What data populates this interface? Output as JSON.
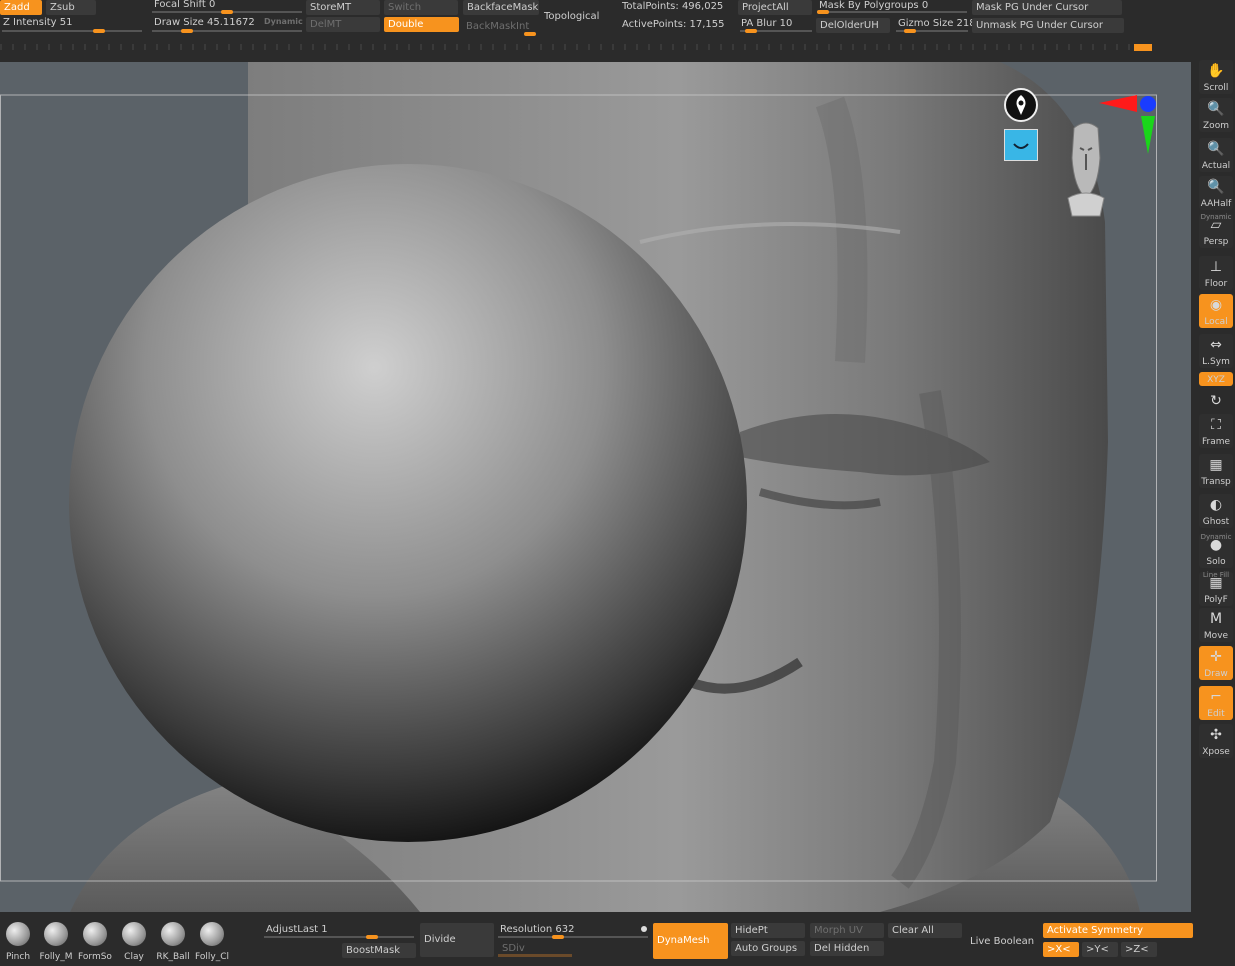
{
  "top": {
    "zadd": "Zadd",
    "zsub": "Zsub",
    "z_intensity": "Z Intensity 51",
    "focal_shift": "Focal Shift 0",
    "draw_size": "Draw Size 45.11672",
    "dynamic": "Dynamic",
    "storemt": "StoreMT",
    "delmt": "DelMT",
    "switch": "Switch",
    "double": "Double",
    "backfacemask": "BackfaceMask",
    "backmaskint": "BackMaskInt",
    "topological": "Topological",
    "total_points": "TotalPoints: 496,025",
    "active_points": "ActivePoints: 17,155",
    "projectall": "ProjectAll",
    "pa_blur": "PA Blur 10",
    "mask_by_polygroups": "Mask By Polygroups 0",
    "delolderuh": "DelOlderUH",
    "gizmo_size": "Gizmo Size 218",
    "mask_pg": "Mask PG Under Cursor",
    "unmask_pg": "Unmask PG Under Cursor"
  },
  "slider_values": {
    "z_intensity": 51,
    "focal_shift": 0,
    "draw_size": 45.11672,
    "pa_blur": 10,
    "gizmo_size": 218
  },
  "right": [
    {
      "label": "Scroll",
      "icon": "hand-icon",
      "glyph": "✋",
      "active": false,
      "top": ""
    },
    {
      "label": "Zoom",
      "icon": "magnifier-icon",
      "glyph": "🔍",
      "active": false,
      "top": ""
    },
    {
      "label": "Actual",
      "icon": "magnifier-icon",
      "glyph": "🔍",
      "active": false,
      "top": ""
    },
    {
      "label": "AAHalf",
      "icon": "magnifier-icon",
      "glyph": "🔍",
      "active": false,
      "top": ""
    },
    {
      "label": "Persp",
      "icon": "perspective-icon",
      "glyph": "▱",
      "active": false,
      "top": "Dynamic"
    },
    {
      "label": "Floor",
      "icon": "floor-icon",
      "glyph": "⊥",
      "active": false,
      "top": ""
    },
    {
      "label": "Local",
      "icon": "local-icon",
      "glyph": "◉",
      "active": true,
      "top": ""
    },
    {
      "label": "L.Sym",
      "icon": "symmetry-icon",
      "glyph": "⇔",
      "active": false,
      "top": ""
    },
    {
      "label": "XYZ",
      "icon": "xyz-icon",
      "glyph": "",
      "active": true,
      "top": ""
    },
    {
      "label": "",
      "icon": "rotate-icon",
      "glyph": "↻",
      "active": false,
      "top": ""
    },
    {
      "label": "Frame",
      "icon": "frame-icon",
      "glyph": "⛶",
      "active": false,
      "top": ""
    },
    {
      "label": "Transp",
      "icon": "transparency-icon",
      "glyph": "▦",
      "active": false,
      "top": ""
    },
    {
      "label": "Ghost",
      "icon": "ghost-icon",
      "glyph": "◐",
      "active": false,
      "top": ""
    },
    {
      "label": "Solo",
      "icon": "solo-icon",
      "glyph": "●",
      "active": false,
      "top": "Dynamic"
    },
    {
      "label": "PolyF",
      "icon": "polyframe-icon",
      "glyph": "▦",
      "active": false,
      "top": "Line Fill"
    },
    {
      "label": "Move",
      "icon": "move-icon",
      "glyph": "M",
      "active": false,
      "top": ""
    },
    {
      "label": "Draw",
      "icon": "draw-icon",
      "glyph": "✛",
      "active": true,
      "top": ""
    },
    {
      "label": "Edit",
      "icon": "edit-icon",
      "glyph": "⌐",
      "active": true,
      "top": ""
    },
    {
      "label": "Xpose",
      "icon": "xpose-icon",
      "glyph": "✣",
      "active": false,
      "top": ""
    }
  ],
  "brushes": [
    {
      "label": "Pinch"
    },
    {
      "label": "Folly_M"
    },
    {
      "label": "FormSo"
    },
    {
      "label": "Clay"
    },
    {
      "label": "RK_Ball"
    },
    {
      "label": "Folly_Cl"
    }
  ],
  "bottom": {
    "adjust_last": "AdjustLast 1",
    "boostmask": "BoostMask",
    "divide": "Divide",
    "resolution": "Resolution 632",
    "sdiv": "SDiv",
    "dynamesh": "DynaMesh",
    "hidept": "HidePt",
    "auto_groups": "Auto Groups",
    "morph_uv": "Morph UV",
    "del_hidden": "Del Hidden",
    "clear_all": "Clear All",
    "live_boolean": "Live Boolean",
    "activate_symmetry": "Activate Symmetry",
    "x": ">X<",
    "y": ">Y<",
    "z": ">Z<"
  },
  "colors": {
    "accent": "#f7931e",
    "viewport_bg": "#5b6268",
    "panel_bg": "#2b2b2b",
    "button_bg": "#3a3a3a"
  }
}
